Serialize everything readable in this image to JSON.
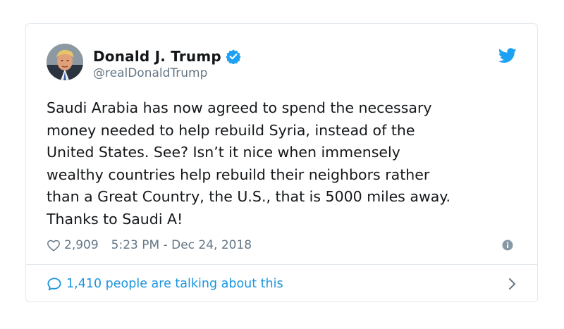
{
  "tweet": {
    "author": {
      "display_name": "Donald J. Trump",
      "handle": "@realDonaldTrump",
      "verified": true
    },
    "text_lines": [
      "Saudi Arabia has now agreed to spend the necessary",
      "money needed to help rebuild Syria, instead of the",
      "United States. See? Isn’t it nice when immensely",
      "wealthy countries help rebuild their neighbors rather",
      "than a Great Country, the U.S., that is 5000 miles away.",
      "Thanks to Saudi A!"
    ],
    "likes": "2,909",
    "timestamp": "5:23 PM - Dec 24, 2018",
    "talking": "1,410 people are talking about this"
  },
  "icons": {
    "brand": "twitter-bird-icon",
    "verified": "verified-badge-icon",
    "like": "heart-outline-icon",
    "info": "info-icon",
    "reply": "speech-bubble-icon",
    "chevron": "chevron-right-icon"
  },
  "colors": {
    "accent": "#1da1f2",
    "link": "#1b95e0",
    "muted": "#657786",
    "text": "#14171a",
    "border": "#e1e8ed"
  }
}
